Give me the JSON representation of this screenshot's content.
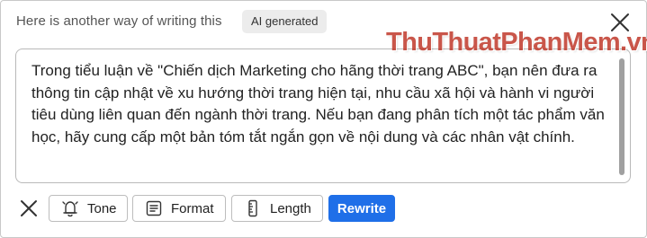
{
  "header": {
    "title": "Here is another way of writing this",
    "badge": "AI generated"
  },
  "watermark": "ThuThuatPhanMem.vn",
  "content": {
    "text": "Trong tiểu luận về \"Chiến dịch Marketing cho hãng thời trang ABC\", bạn nên đưa ra thông tin cập nhật về xu hướng thời trang hiện tại, nhu cầu xã hội và hành vi người tiêu dùng liên quan đến ngành thời trang. Nếu bạn đang phân tích một tác phẩm văn học, hãy cung cấp một bản tóm tắt ngắn gọn về nội dung và các nhân vật chính."
  },
  "toolbar": {
    "tone_label": "Tone",
    "format_label": "Format",
    "length_label": "Length",
    "rewrite_label": "Rewrite"
  },
  "colors": {
    "accent": "#1f6fe8",
    "watermark": "#c0392b"
  },
  "icons": [
    "close-icon",
    "bell-icon",
    "format-icon",
    "ruler-icon"
  ]
}
